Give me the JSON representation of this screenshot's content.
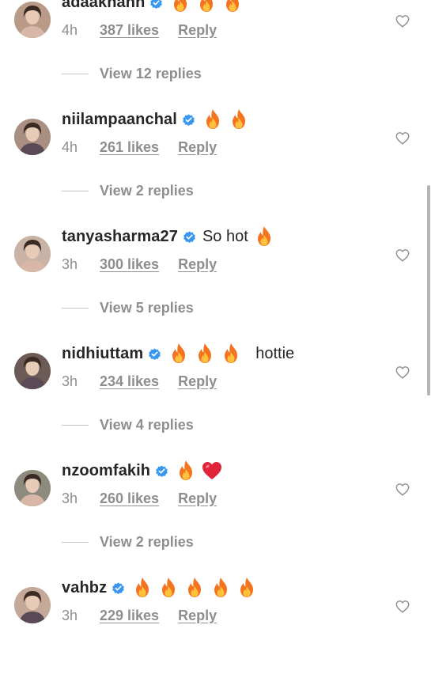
{
  "comments": [
    {
      "username": "adaakhann",
      "text": "",
      "emojis": [
        "fire",
        "fire",
        "fire"
      ],
      "time": "4h",
      "likes": "387 likes",
      "reply": "Reply",
      "view_replies": "View 12 replies",
      "avatar_color": "#b89a86"
    },
    {
      "username": "niilampaanchal",
      "text": "",
      "emojis": [
        "fire",
        "fire"
      ],
      "time": "4h",
      "likes": "261 likes",
      "reply": "Reply",
      "view_replies": "View 2 replies",
      "avatar_color": "#a88f82"
    },
    {
      "username": "tanyasharma27",
      "text": "So hot",
      "emojis": [
        "fire"
      ],
      "time": "3h",
      "likes": "300 likes",
      "reply": "Reply",
      "view_replies": "View 5 replies",
      "avatar_color": "#c9b3a6"
    },
    {
      "username": "nidhiuttam",
      "text": "",
      "emojis": [
        "fire",
        "fire",
        "fire"
      ],
      "text_after": "hottie",
      "time": "3h",
      "likes": "234 likes",
      "reply": "Reply",
      "view_replies": "View 4 replies",
      "avatar_color": "#6b5a55"
    },
    {
      "username": "nzoomfakih",
      "text": "",
      "emojis": [
        "fire",
        "heart"
      ],
      "time": "3h",
      "likes": "260 likes",
      "reply": "Reply",
      "view_replies": "View 2 replies",
      "avatar_color": "#8d8a7e"
    },
    {
      "username": "vahbz",
      "text": "",
      "emojis": [
        "fire",
        "fire",
        "fire",
        "fire",
        "fire"
      ],
      "time": "3h",
      "likes": "229 likes",
      "reply": "Reply",
      "view_replies": "",
      "avatar_color": "#c4a898"
    }
  ],
  "colors": {
    "text": "#262626",
    "secondary": "#8e8e8e",
    "verified": "#3897f0",
    "heart_red": "#e0243a"
  }
}
